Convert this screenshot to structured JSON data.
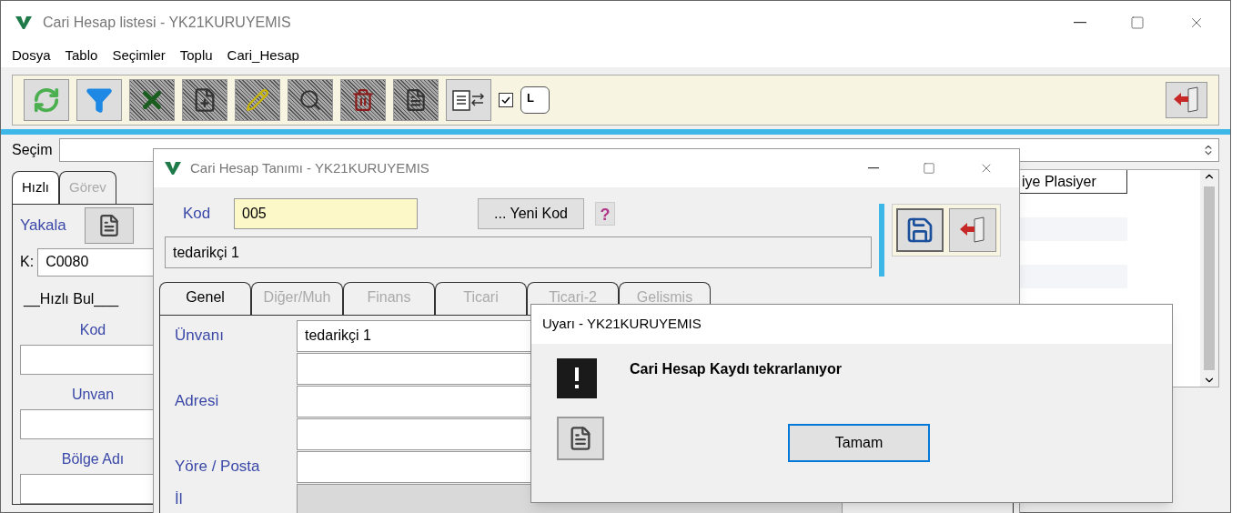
{
  "main_window": {
    "title": "Cari Hesap listesi - YK21KURUYEMIS",
    "menu": [
      "Dosya",
      "Tablo",
      "Seçimler",
      "Toplu",
      "Cari_Hesap"
    ],
    "toolbar": {
      "checkbox": {
        "checked": true
      },
      "key_label": "L"
    },
    "selection_label": "Seçim",
    "left_panel": {
      "tabs": [
        {
          "label": "Hızlı",
          "selected": true
        },
        {
          "label": "Görev",
          "selected": false
        }
      ],
      "catch_label": "Yakala",
      "k_label": "K:",
      "k_value": "C0080",
      "quick_find": "__Hızlı Bul___",
      "search_fields": [
        {
          "label": "Kod"
        },
        {
          "label": "Unvan"
        },
        {
          "label": "Bölge Adı"
        }
      ]
    },
    "grid": {
      "column_header": "iye Plasiyer"
    }
  },
  "dialog": {
    "title": "Cari Hesap Tanımı - YK21KURUYEMIS",
    "code_label": "Kod",
    "code_value": "005",
    "new_code_button": "... Yeni Kod",
    "help": "?",
    "name_value": "tedarikçi 1",
    "tabs": [
      {
        "label": "Genel",
        "selected": true
      },
      {
        "label": "Diğer/Muh",
        "selected": false
      },
      {
        "label": "Finans",
        "selected": false
      },
      {
        "label": "Ticari",
        "selected": false
      },
      {
        "label": "Ticari-2",
        "selected": false
      },
      {
        "label": "Gelismis",
        "selected": false
      }
    ],
    "fields": [
      {
        "label": "Ünvanı",
        "value": "tedarikçi 1",
        "disabled": false
      },
      {
        "disabled": false
      },
      {
        "label": "Adresi",
        "disabled": false
      },
      {
        "disabled": false
      },
      {
        "label": "Yöre / Posta",
        "disabled": false
      },
      {
        "label": "İl",
        "disabled": true
      }
    ]
  },
  "alert": {
    "title": "Uyarı - YK21KURUYEMIS",
    "message": "Cari Hesap Kaydı tekrarlanıyor",
    "ok_button": "Tamam"
  }
}
